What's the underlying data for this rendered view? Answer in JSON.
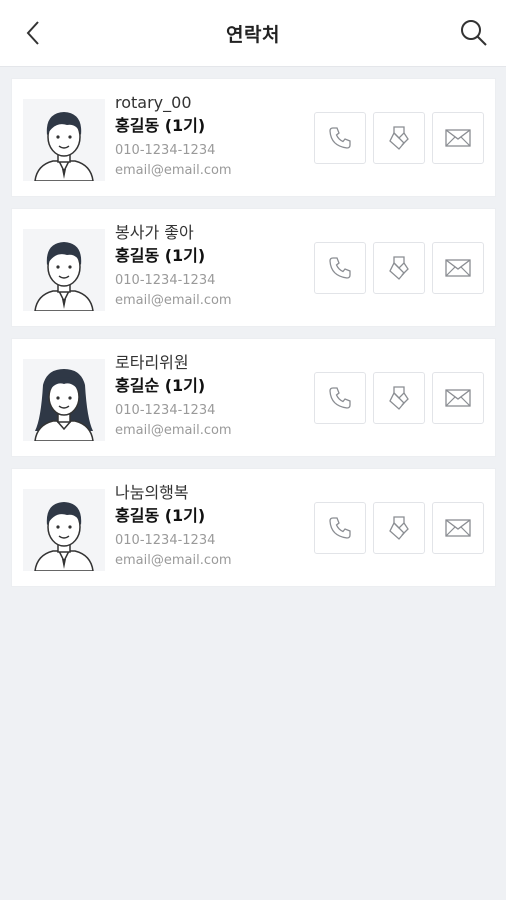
{
  "header": {
    "title": "연락처",
    "back_icon": "chevron-left-icon",
    "search_icon": "search-icon"
  },
  "contacts": [
    {
      "group": "rotary_00",
      "name": "홍길동 (1기)",
      "phone": "010-1234-1234",
      "email": "email@email.com",
      "avatar": "male-avatar"
    },
    {
      "group": "봉사가 좋아",
      "name": "홍길동 (1기)",
      "phone": "010-1234-1234",
      "email": "email@email.com",
      "avatar": "male-avatar"
    },
    {
      "group": "로타리위원",
      "name": "홍길순 (1기)",
      "phone": "010-1234-1234",
      "email": "email@email.com",
      "avatar": "female-avatar"
    },
    {
      "group": "나눔의행복",
      "name": "홍길동 (1기)",
      "phone": "010-1234-1234",
      "email": "email@email.com",
      "avatar": "male-avatar"
    }
  ],
  "actions": {
    "call_icon": "phone-icon",
    "ribbon_icon": "ribbon-icon",
    "mail_icon": "mail-icon"
  },
  "colors": {
    "background": "#eff1f4",
    "card": "#ffffff",
    "icon_stroke": "#8a8d92"
  }
}
